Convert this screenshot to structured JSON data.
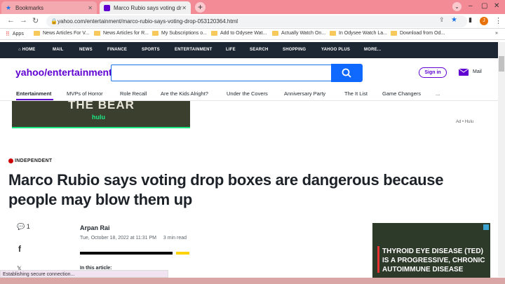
{
  "browser": {
    "tabs": [
      {
        "title": "Bookmarks"
      },
      {
        "title": "Marco Rubio says voting drop bo"
      }
    ],
    "url": "yahoo.com/entertainment/marco-rubio-says-voting-drop-053120364.html",
    "bookmarks": [
      "Apps",
      "News Articles For V...",
      "News Articles for R...",
      "My Subscriptions o...",
      "Add to Odysee Wat...",
      "Actually Watch On...",
      "In Odysee Watch La...",
      "Download from Od..."
    ],
    "profile_initial": "J"
  },
  "yahoo_nav": [
    "HOME",
    "MAIL",
    "NEWS",
    "FINANCE",
    "SPORTS",
    "ENTERTAINMENT",
    "LIFE",
    "SEARCH",
    "SHOPPING",
    "YAHOO PLUS",
    "MORE..."
  ],
  "header": {
    "logo_main": "yahoo/",
    "logo_section": "entertainment",
    "search_placeholder": "",
    "signin": "Sign in",
    "mail": "Mail"
  },
  "subnav": [
    "Entertainment",
    "MVPs of Horror",
    "Role Recall",
    "Are the Kids Alright?",
    "Under the Covers",
    "Anniversary Party",
    "The It List",
    "Game Changers",
    "..."
  ],
  "ad": {
    "title": "THE BEAR",
    "brand": "hulu",
    "label": "Ad • Hulu"
  },
  "article": {
    "publisher": "INDEPENDENT",
    "headline": "Marco Rubio says voting drop boxes are dangerous because people may blow them up",
    "comments": "1",
    "author": "Arpan Rai",
    "date": "Tue, October 18, 2022 at 11:31 PM",
    "read_time": "3 min read",
    "in_this_article": "In this article:"
  },
  "side_ad": {
    "text": "THYROID EYE DISEASE (TED) IS A PROGRESSIVE, CHRONIC AUTOIMMUNE DISEASE"
  },
  "status_bar": "Establishing secure connection..."
}
